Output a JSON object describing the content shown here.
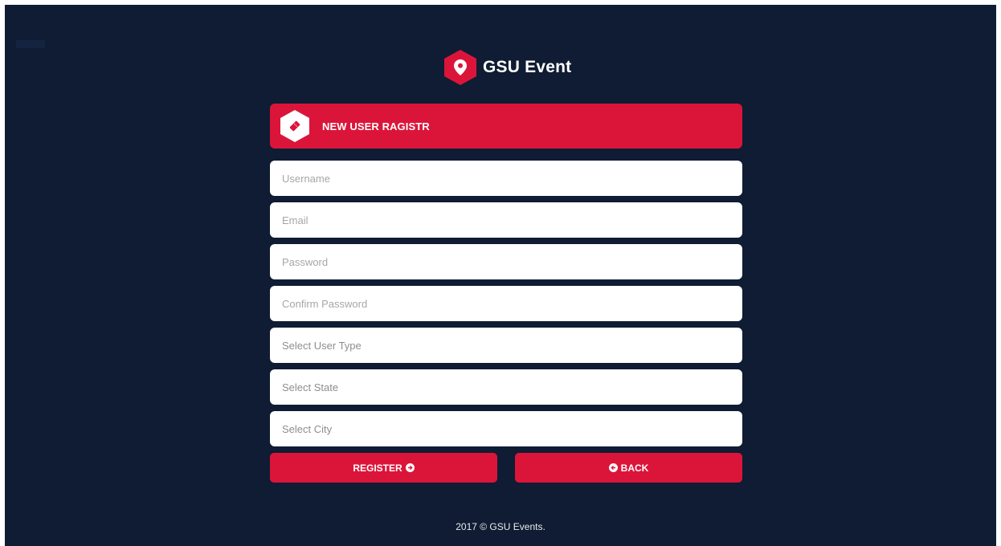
{
  "brand": {
    "name": "GSU Event",
    "logo_icon": "map-pin-icon",
    "accent_color": "#db1539"
  },
  "header": {
    "title": "NEW USER RAGISTR",
    "icon": "ticket-icon"
  },
  "form": {
    "username_placeholder": "Username",
    "email_placeholder": "Email",
    "password_placeholder": "Password",
    "confirm_password_placeholder": "Confirm Password",
    "user_type_label": "Select User Type",
    "state_label": "Select State",
    "city_label": "Select City"
  },
  "buttons": {
    "register_label": "REGISTER",
    "back_label": "BACK"
  },
  "footer": {
    "text": "2017 © GSU Events."
  },
  "colors": {
    "background": "#0f1c33",
    "accent": "#db1539"
  }
}
